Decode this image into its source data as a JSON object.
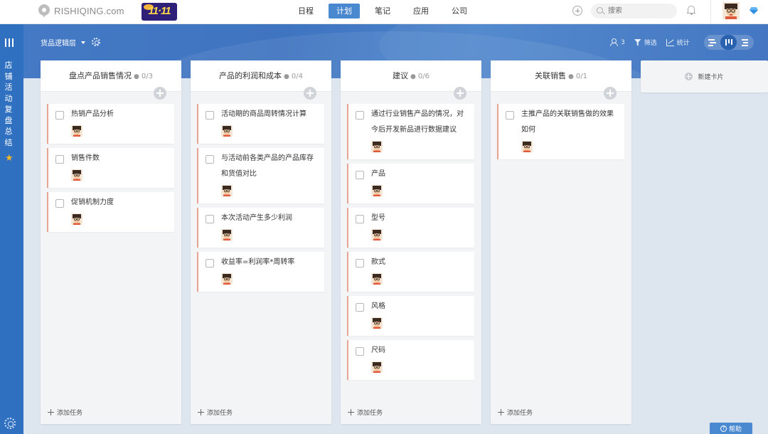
{
  "topbar": {
    "logo_text": "RISHIQING.com",
    "promo_text": "11·11",
    "nav": [
      {
        "label": "日程",
        "active": false
      },
      {
        "label": "计划",
        "active": true
      },
      {
        "label": "笔记",
        "active": false
      },
      {
        "label": "应用",
        "active": false
      },
      {
        "label": "公司",
        "active": false
      }
    ],
    "search_placeholder": "搜索"
  },
  "sidebar": {
    "title_chars": [
      "店",
      "铺",
      "活",
      "动",
      "复",
      "盘",
      "总",
      "结"
    ],
    "star": "★"
  },
  "board": {
    "name": "货品逻辑层",
    "member_count": "3",
    "filter_label": "筛选",
    "stats_label": "统计",
    "columns": [
      {
        "title": "盘点产品销售情况",
        "count": "0/3",
        "cards": [
          "热销产品分析",
          "销售件数",
          "促销机制力度"
        ],
        "add_task": "添加任务"
      },
      {
        "title": "产品的利润和成本",
        "count": "0/4",
        "cards": [
          "活动期的商品周转情况计算",
          "与活动前各类产品的产品库存和货值对比",
          "本次活动产生多少利润",
          "收益率=利润率*周转率"
        ],
        "add_task": "添加任务"
      },
      {
        "title": "建议",
        "count": "0/6",
        "cards": [
          "通过行业销售产品的情况，对今后开发新品进行数据建议",
          "产品",
          "型号",
          "款式",
          "风格",
          "尺码"
        ],
        "add_task": "添加任务"
      },
      {
        "title": "关联销售",
        "count": "0/1",
        "cards": [
          "主推产品的关联销售做的效果如何"
        ],
        "add_task": "添加任务"
      }
    ],
    "new_card_label": "新建卡片"
  },
  "help_label": "帮助",
  "colors": {
    "rail": "#3070c0",
    "accent": "#4a88d0",
    "card_border": "#e8a493",
    "column_bg": "#f3f4f6"
  }
}
